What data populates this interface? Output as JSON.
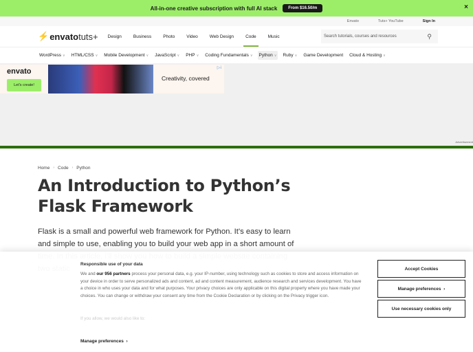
{
  "promo": {
    "text": "All-in-one creative subscription with full AI stack",
    "button": "From $16.50/m",
    "close": "×"
  },
  "util": {
    "links": [
      "Envato",
      "Tuts+ YouTube",
      "Sign In"
    ]
  },
  "header": {
    "logo_main": "envato",
    "logo_sub": "tuts+",
    "nav": [
      "Design",
      "Business",
      "Photo",
      "Video",
      "Web Design",
      "Code",
      "Music"
    ],
    "active": "Code",
    "search_placeholder": "Search tutorials, courses and resources"
  },
  "subnav": {
    "items": [
      {
        "label": "WordPress",
        "chev": true
      },
      {
        "label": "HTML/CSS",
        "chev": true
      },
      {
        "label": "Mobile Development",
        "chev": true
      },
      {
        "label": "JavaScript",
        "chev": true
      },
      {
        "label": "PHP",
        "chev": true
      },
      {
        "label": "Coding Fundamentals",
        "chev": true
      },
      {
        "label": "Python",
        "chev": true,
        "active": true
      },
      {
        "label": "Ruby",
        "chev": true
      },
      {
        "label": "Game Development",
        "chev": false
      },
      {
        "label": "Cloud & Hosting",
        "chev": true
      }
    ]
  },
  "ad": {
    "brand": "envato",
    "cta": "Let's create!",
    "headline": "Creativity, covered",
    "label": "Advertisement"
  },
  "breadcrumb": [
    "Home",
    "Code",
    "Python"
  ],
  "article": {
    "title": "An Introduction to Python’s Flask Framework",
    "lead": "Flask is a small and powerful web framework for Python. It's easy to learn and simple to use, enabling you to build your web app in a short amount of time. In this article, I'll show you how to build a simple website containing two static"
  },
  "cookie": {
    "title": "Responsible use of your data",
    "body_pre": "We and ",
    "partners": "our 956 partners",
    "body_post": " process your personal data, e.g. your IP-number, using technology such as cookies to store and access information on your device in order to serve personalized ads and content, ad and content measurement, audience research and services development. You have a choice in who uses your data and for what purposes. Your privacy choices are only applicable on this digital property where you have made your choices. You can change or withdraw your consent any time from the Cookie Declaration or by clicking on the Privacy trigger icon.",
    "also": "If you allow, we would also like to:",
    "manage_link": "Manage preferences",
    "accept": "Accept Cookies",
    "manage_btn": "Manage preferences",
    "necessary": "Use necessary cookies only"
  }
}
